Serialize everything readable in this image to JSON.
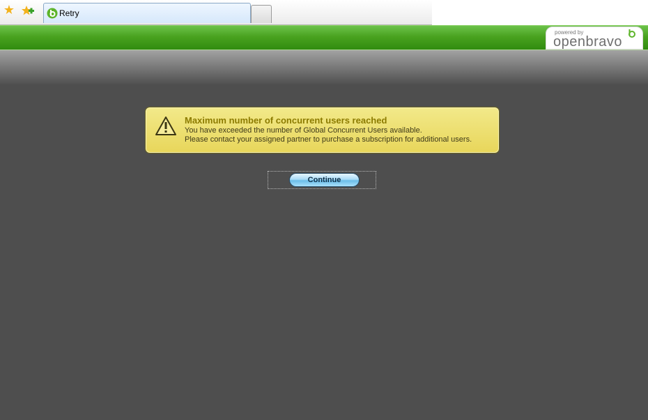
{
  "browser": {
    "tab_title": "Retry",
    "icons": {
      "favorite": "star-icon",
      "add_favorite": "add-favorite-icon",
      "tab": "openbravo-favicon-icon"
    }
  },
  "header": {
    "logo": {
      "tagline": "powered by",
      "name": "openbravo"
    },
    "colors": {
      "bar": "#49a21f",
      "logo_accent": "#5db42a"
    }
  },
  "alert": {
    "title": "Maximum number of concurrent users reached",
    "line1": "You have exceeded the number of Global Concurrent Users available.",
    "line2": "Please contact your assigned partner to purchase a subscription for additional users.",
    "icon": "warning-icon",
    "colors": {
      "background": "#ece07a",
      "title": "#8c7b00"
    }
  },
  "actions": {
    "continue_label": "Continue"
  }
}
